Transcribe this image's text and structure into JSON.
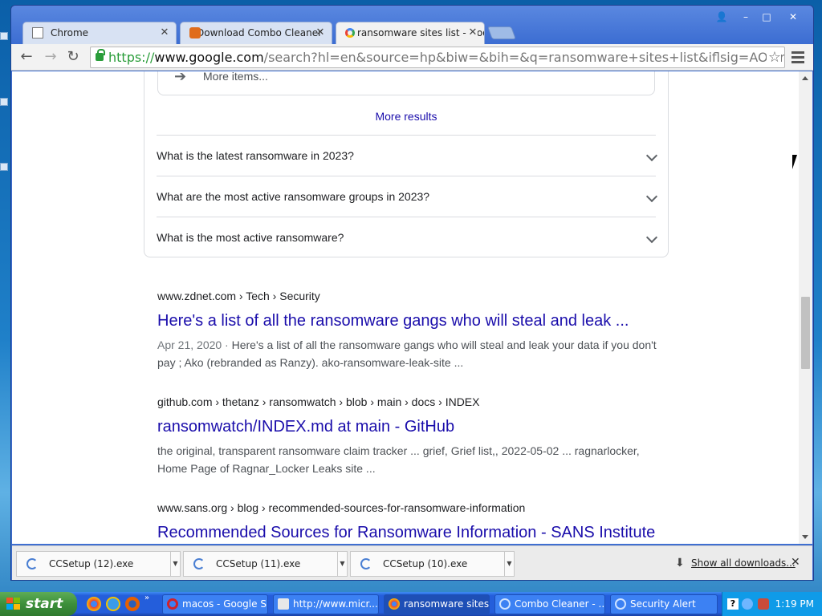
{
  "window_controls": {
    "minimize": "–",
    "maximize": "□",
    "close": "✕"
  },
  "tabs": [
    {
      "label": "Chrome",
      "close": "✕"
    },
    {
      "label": "Download Combo Cleaner",
      "close": "✕"
    },
    {
      "label": "ransomware sites list - Googl",
      "close": "✕"
    }
  ],
  "toolbar": {
    "back": "←",
    "forward": "→",
    "reload": "↻",
    "url_scheme": "https://",
    "url_host": "www.google.com",
    "url_path": "/search?hl=en&source=hp&biw=&bih=&q=ransomware+sites+list&iflsig=AOEireoAAAAA",
    "star": "☆"
  },
  "content": {
    "more_items": "More items...",
    "more_results": "More results",
    "questions": [
      "What is the latest ransomware in 2023?",
      "What are the most active ransomware groups in 2023?",
      "What is the most active ransomware?"
    ],
    "results": [
      {
        "breadcrumb": "www.zdnet.com › Tech › Security",
        "title": "Here's a list of all the ransomware gangs who will steal and leak ...",
        "date": "Apr 21, 2020 · ",
        "snippet": "Here's a list of all the ransomware gangs who will steal and leak your data if you don't pay ; Ako (rebranded as Ranzy). ako-ransomware-leak-site ..."
      },
      {
        "breadcrumb": "github.com › thetanz › ransomwatch › blob › main › docs › INDEX",
        "title": "ransomwatch/INDEX.md at main - GitHub",
        "date": "",
        "snippet": "the original, transparent ransomware claim tracker ... grief, Grief list,, 2022-05-02 ... ragnarlocker, Home Page of Ragnar_Locker Leaks site ..."
      },
      {
        "breadcrumb": "www.sans.org › blog › recommended-sources-for-ransomware-information",
        "title": "Recommended Sources for Ransomware Information - SANS Institute",
        "date": "",
        "snippet": ""
      }
    ]
  },
  "downloads": {
    "items": [
      {
        "name": "CCSetup (12).exe"
      },
      {
        "name": "CCSetup (11).exe"
      },
      {
        "name": "CCSetup (10).exe"
      }
    ],
    "show_all": "Show all downloads...",
    "close": "✕"
  },
  "taskbar": {
    "start": "start",
    "buttons": [
      {
        "label": "macos - Google S..."
      },
      {
        "label": "http://www.micr..."
      },
      {
        "label": "ransomware sites..."
      },
      {
        "label": "Combo Cleaner - ..."
      },
      {
        "label": "Security Alert"
      }
    ],
    "clock": "1:19 PM"
  },
  "colors": {
    "link": "#1a0dab",
    "xp_blue": "#245edb",
    "start_green": "#3c8f3a"
  },
  "icons": [
    "back-icon",
    "forward-icon",
    "reload-icon",
    "lock-icon",
    "star-icon",
    "menu-icon",
    "chevron-down-icon",
    "download-icon",
    "close-icon"
  ]
}
